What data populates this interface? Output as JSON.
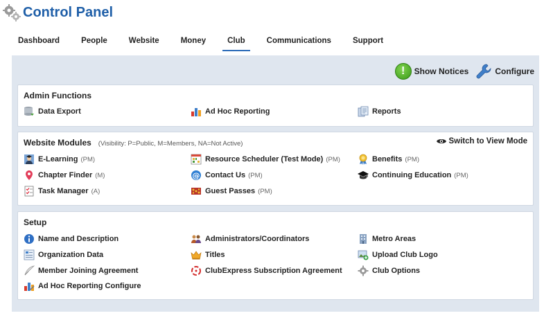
{
  "header": {
    "title": "Control Panel"
  },
  "tabs": [
    {
      "label": "Dashboard"
    },
    {
      "label": "People"
    },
    {
      "label": "Website"
    },
    {
      "label": "Money"
    },
    {
      "label": "Club"
    },
    {
      "label": "Communications"
    },
    {
      "label": "Support"
    }
  ],
  "toolbar": {
    "show_notices": "Show Notices",
    "configure": "Configure"
  },
  "admin": {
    "title": "Admin Functions",
    "items": [
      "Data Export",
      "Ad Hoc Reporting",
      "Reports"
    ]
  },
  "modules": {
    "title": "Website Modules",
    "note": "(Visibility: P=Public, M=Members, NA=Not Active)",
    "switch": "Switch to View Mode",
    "items": [
      {
        "label": "E-Learning",
        "vis": "(PM)"
      },
      {
        "label": "Resource Scheduler (Test Mode)",
        "vis": "(PM)"
      },
      {
        "label": "Benefits",
        "vis": "(PM)"
      },
      {
        "label": "Chapter Finder",
        "vis": "(M)"
      },
      {
        "label": "Contact Us",
        "vis": "(PM)"
      },
      {
        "label": "Continuing Education",
        "vis": "(PM)"
      },
      {
        "label": "Task Manager",
        "vis": "(A)"
      },
      {
        "label": "Guest Passes",
        "vis": "(PM)"
      }
    ]
  },
  "setup": {
    "title": "Setup",
    "items": [
      "Name and Description",
      "Administrators/Coordinators",
      "Metro Areas",
      "Organization Data",
      "Titles",
      "Upload Club Logo",
      "Member Joining Agreement",
      "ClubExpress Subscription Agreement",
      "Club Options",
      "Ad Hoc Reporting Configure"
    ]
  },
  "icons": [
    "gears-icon",
    "exclamation-icon",
    "wrench-icon",
    "database-icon",
    "bar-chart-icon",
    "documents-icon",
    "eye-icon",
    "graduate-icon",
    "calendar-grid-icon",
    "award-icon",
    "map-pin-icon",
    "at-sign-icon",
    "mortarboard-icon",
    "checklist-icon",
    "ticket-icon",
    "info-icon",
    "people-icon",
    "building-icon",
    "org-data-icon",
    "crown-icon",
    "upload-image-icon",
    "quill-icon",
    "clubexpress-icon",
    "gear-icon",
    "chart-config-icon"
  ]
}
